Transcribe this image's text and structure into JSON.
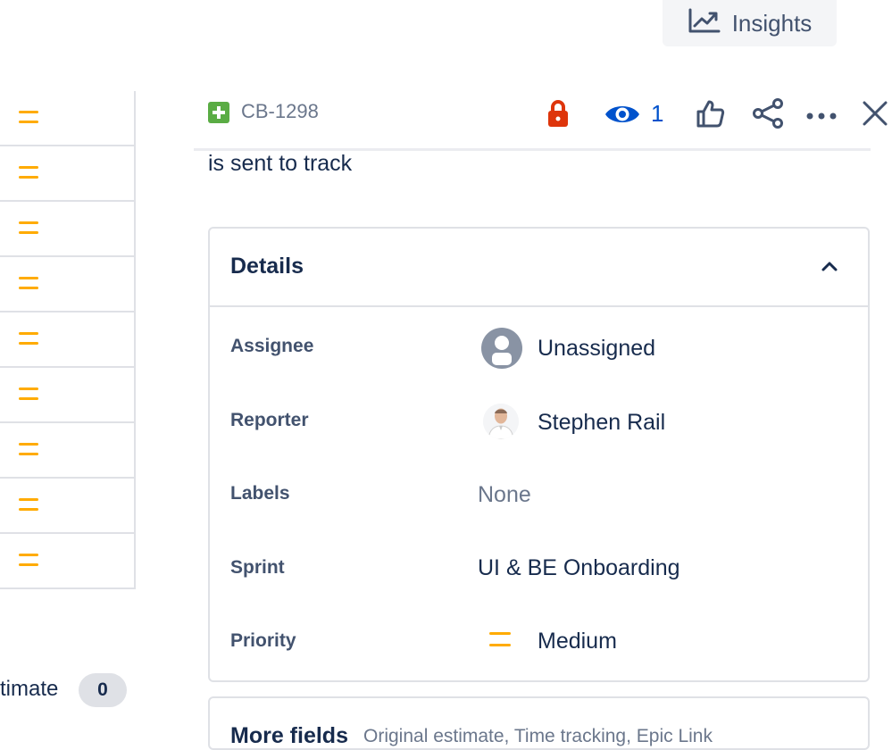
{
  "toolbar": {
    "insights_label": "Insights",
    "insights_icon": "trend-chart-icon"
  },
  "left_list": {
    "rows": [
      {
        "priority_icon": "priority-medium-icon"
      },
      {
        "priority_icon": "priority-medium-icon"
      },
      {
        "priority_icon": "priority-medium-icon"
      },
      {
        "priority_icon": "priority-medium-icon"
      },
      {
        "priority_icon": "priority-medium-icon"
      },
      {
        "priority_icon": "priority-medium-icon"
      },
      {
        "priority_icon": "priority-medium-icon"
      },
      {
        "priority_icon": "priority-medium-icon"
      },
      {
        "priority_icon": "priority-medium-icon"
      }
    ],
    "estimate_label": "timate",
    "estimate_value": "0"
  },
  "issue": {
    "key": "CB-1298",
    "type_icon": "story-add-icon",
    "watch_count": "1",
    "description_fragment": "is sent to track"
  },
  "details": {
    "title": "Details",
    "fields": {
      "assignee": {
        "label": "Assignee",
        "value": "Unassigned"
      },
      "reporter": {
        "label": "Reporter",
        "value": "Stephen Rail"
      },
      "labels": {
        "label": "Labels",
        "value": "None"
      },
      "sprint": {
        "label": "Sprint",
        "value": "UI & BE Onboarding"
      },
      "priority": {
        "label": "Priority",
        "value": "Medium"
      }
    }
  },
  "more_fields": {
    "title": "More fields",
    "subtitle": "Original estimate, Time tracking, Epic Link"
  },
  "colors": {
    "lock": "#de350b",
    "watch": "#0052cc",
    "priority_medium": "#ffab00",
    "story_green": "#5aac44"
  }
}
